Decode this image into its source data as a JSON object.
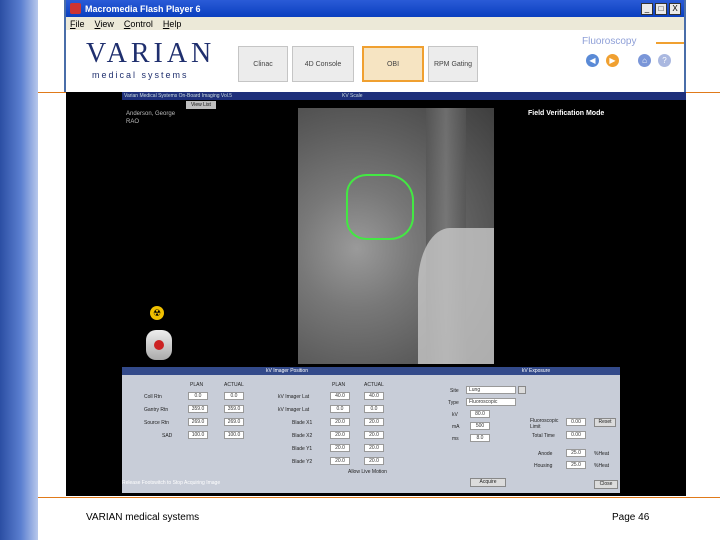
{
  "window": {
    "title": "Macromedia Flash Player 6",
    "controls": [
      "_",
      "□",
      "X"
    ],
    "menu": [
      "File",
      "View",
      "Control",
      "Help"
    ]
  },
  "header": {
    "logo_top": "VARIAN",
    "logo_bottom": "medical systems",
    "tabs": [
      {
        "label": "Clinac"
      },
      {
        "label": "4D Console"
      },
      {
        "label": "OBI"
      },
      {
        "label": "RPM Gating"
      }
    ],
    "active_tab": "OBI",
    "section_title": "Fluoroscopy",
    "nav_icons": [
      "back-icon",
      "forward-icon",
      "home-icon",
      "help-icon"
    ]
  },
  "app": {
    "title": "Varian Medical Systems  On-Board Imaging Vol.5",
    "subtitle": "KV Scale",
    "buttons": [
      "View List"
    ],
    "patient": [
      "Anderson, George",
      "RAO"
    ],
    "mode": "Field Verification Mode",
    "panel_left_title": "kV Imager Position",
    "panel_right_title": "kV Exposure",
    "columns": [
      "PLAN",
      "ACTUAL"
    ],
    "left_rows": [
      {
        "label": "Coll Rtn",
        "plan": "0.0",
        "actual": "0.0"
      },
      {
        "label": "Gantry Rtn",
        "plan": "359.0",
        "actual": "359.0"
      },
      {
        "label": "Source Rtn",
        "plan": "269.0",
        "actual": "269.0"
      },
      {
        "label": "SAD",
        "plan": "100.0",
        "actual": "100.0"
      }
    ],
    "mid_rows": [
      {
        "label": "kV Imager Lat",
        "plan": "40.0",
        "actual": "40.0"
      },
      {
        "label": "kV Imager Lat",
        "plan": "0.0",
        "actual": "0.0"
      },
      {
        "label": "Blade X1",
        "plan": "20.0",
        "actual": "20.0"
      },
      {
        "label": "Blade X2",
        "plan": "20.0",
        "actual": "20.0"
      },
      {
        "label": "Blade Y1",
        "plan": "20.0",
        "actual": "20.0"
      },
      {
        "label": "Blade Y2",
        "plan": "20.0",
        "actual": "20.0"
      }
    ],
    "exposure_rows": [
      {
        "label": "Site",
        "value": "Lung"
      },
      {
        "label": "Type",
        "value": "Fluoroscopic"
      },
      {
        "label": "kV",
        "value": "80.0"
      },
      {
        "label": "mA",
        "value": "500"
      },
      {
        "label": "ms",
        "value": "8.0"
      }
    ],
    "timer_rows": [
      {
        "label": "Fluoroscopic Limit",
        "value": "0.00",
        "btn": "Reset"
      },
      {
        "label": "Total Time",
        "value": "0.00",
        "btn": ""
      },
      {
        "label": "Anode",
        "value": "25.0",
        "btn": "%Heat"
      },
      {
        "label": "Housing",
        "value": "25.0",
        "btn": "%Heat"
      }
    ],
    "allow_motion": "Allow Live Motion",
    "acquire": "Acquire",
    "close": "Close",
    "status": "Release Footswitch to Stop Acquiring Image"
  },
  "footer": {
    "company": "VARIAN medical systems",
    "page": "Page 46"
  },
  "colors": {
    "field_outline": "#43e843",
    "accent_orange": "#f0a030",
    "title_blue": "#0a3fbf"
  }
}
